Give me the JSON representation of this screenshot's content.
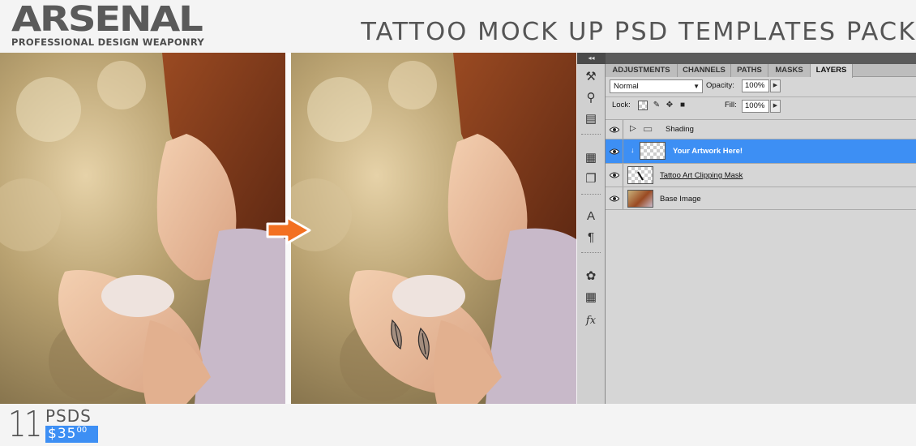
{
  "header": {
    "brand": "ARSENAL",
    "tagline": "PROFESSIONAL DESIGN WEAPONRY",
    "title": "TATTOO MOCK UP PSD TEMPLATES PACK"
  },
  "footer": {
    "count": "11",
    "unit": "PSDS",
    "price_main": "$35",
    "price_cents": "00"
  },
  "photoshop": {
    "collapse_glyph": "◂◂",
    "tabs": [
      {
        "label": "ADJUSTMENTS",
        "active": false
      },
      {
        "label": "CHANNELS",
        "active": false
      },
      {
        "label": "PATHS",
        "active": false
      },
      {
        "label": "MASKS",
        "active": false
      },
      {
        "label": "LAYERS",
        "active": true
      }
    ],
    "blend_mode": "Normal",
    "opacity_label": "Opacity:",
    "opacity_value": "100%",
    "lock_label": "Lock:",
    "fill_label": "Fill:",
    "fill_value": "100%",
    "layers": [
      {
        "name": "Shading",
        "type": "group",
        "selected": false
      },
      {
        "name": "Your Artwork Here!",
        "type": "smart-object",
        "selected": true
      },
      {
        "name": "Tattoo Art Clipping Mask",
        "type": "layer",
        "selected": false
      },
      {
        "name": "Base Image",
        "type": "layer",
        "selected": false
      }
    ],
    "side_tools": [
      "brush-presets-icon",
      "clone-source-icon",
      "tool-presets-icon",
      "info-icon",
      "character-icon",
      "paragraph-icon",
      "swatches-icon",
      "styles-icon",
      "fx-icon"
    ]
  },
  "colors": {
    "accent_blue": "#3d8ff4",
    "arrow_orange": "#f37021",
    "text_gray": "#555555"
  }
}
